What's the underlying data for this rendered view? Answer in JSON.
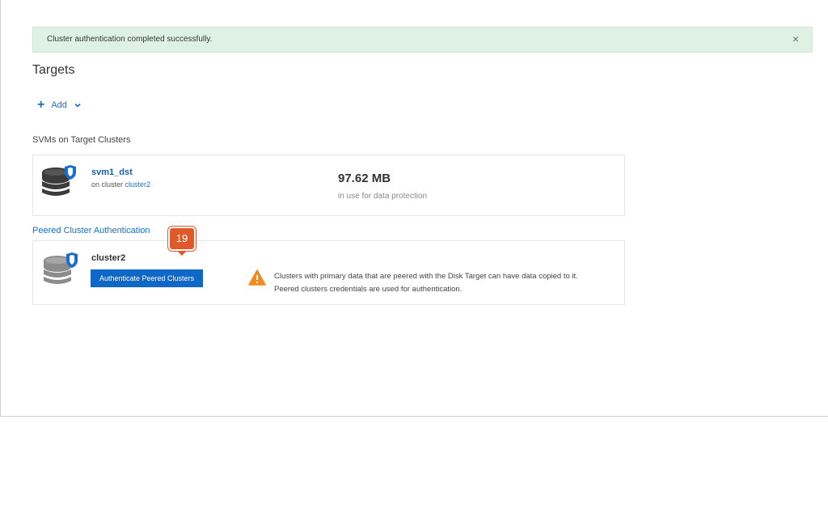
{
  "banner": {
    "message": "Cluster authentication completed successfully.",
    "close_icon": "×"
  },
  "page": {
    "title": "Targets"
  },
  "toolbar": {
    "add_label": "Add",
    "add_plus": "+"
  },
  "svm_section": {
    "label": "SVMs on Target Clusters",
    "card": {
      "name": "svm1_dst",
      "on_cluster_prefix": "on cluster",
      "cluster_link": "cluster2",
      "usage_value": "97.62  MB",
      "usage_label": "in use for data protection",
      "icon": "database-shield-icon"
    }
  },
  "peer_section": {
    "label": "Peered Cluster Authentication",
    "card": {
      "name": "cluster2",
      "button_label": "Authenticate Peered Clusters",
      "warning_line1": "Clusters with primary data that are peered with the Disk Target can have data copied to it.",
      "warning_line2": "Peered clusters credentials are used for authentication.",
      "icon": "database-shield-icon",
      "warning_icon": "warning-triangle-icon"
    }
  },
  "callout": {
    "number": "19"
  },
  "colors": {
    "accent": "#1a6ec9",
    "button": "#0f67c6",
    "success_bg": "#dff1e4",
    "warning": "#f08a1c",
    "callout": "#e0592b"
  }
}
